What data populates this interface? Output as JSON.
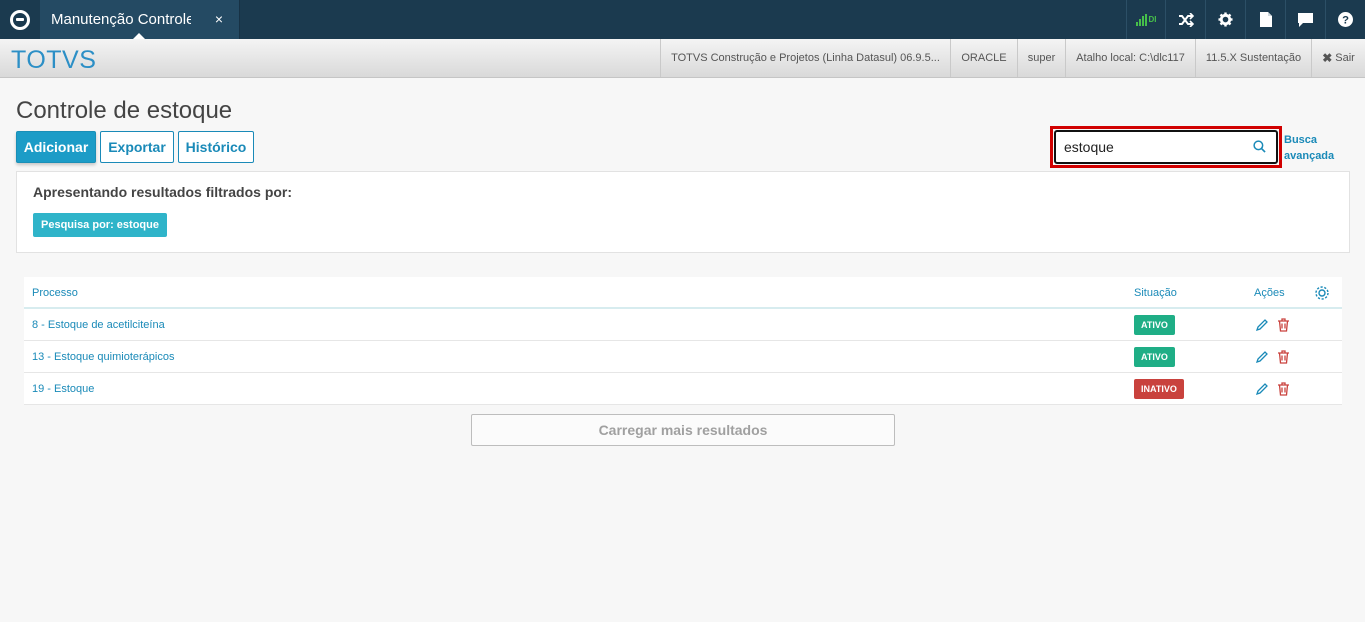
{
  "topbar": {
    "tab_title": "Manutenção Controle c",
    "tab_close": "×",
    "signal_text": "DI",
    "icons": [
      "logo-icon",
      "signal-icon",
      "shuffle-icon",
      "gear-icon",
      "document-icon",
      "chat-icon",
      "help-icon"
    ],
    "help": "?"
  },
  "header": {
    "brand": "TOTVS",
    "info": [
      "TOTVS Construção e Projetos (Linha Datasul) 06.9.5...",
      "ORACLE",
      "super",
      "Atalho local: C:\\dlc117",
      "11.5.X Sustentação"
    ],
    "exit_label": "Sair"
  },
  "page": {
    "title": "Controle de estoque",
    "buttons": {
      "add": "Adicionar",
      "export": "Exportar",
      "history": "Histórico"
    },
    "search": {
      "value": "estoque",
      "advanced_line1": "Busca",
      "advanced_line2": "avançada"
    },
    "filter": {
      "title": "Apresentando resultados filtrados por:",
      "tag": "Pesquisa por: estoque"
    },
    "table": {
      "headers": {
        "process": "Processo",
        "status": "Situação",
        "actions": "Ações"
      },
      "rows": [
        {
          "process": "8 - Estoque de acetilciteína",
          "status": "ATIVO"
        },
        {
          "process": "13 - Estoque quimioterápicos",
          "status": "ATIVO"
        },
        {
          "process": "19 - Estoque",
          "status": "INATIVO"
        }
      ]
    },
    "load_more": "Carregar mais resultados"
  },
  "colors": {
    "topbar": "#1b3a4f",
    "accent": "#1c9cc7",
    "active_badge": "#1fae86",
    "inactive_badge": "#c9423d",
    "highlight": "#d10000"
  }
}
